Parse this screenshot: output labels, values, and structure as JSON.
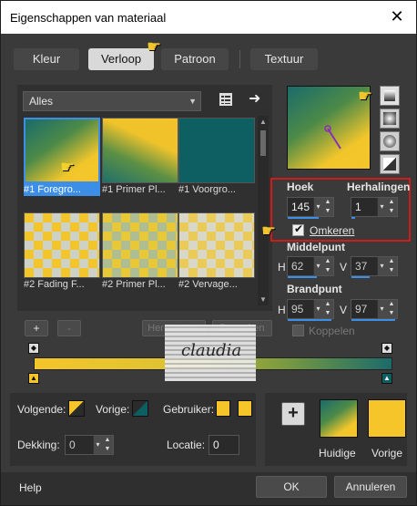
{
  "window": {
    "title": "Eigenschappen van materiaal",
    "close_glyph": "✕"
  },
  "tabs": [
    {
      "label": "Kleur",
      "active": false
    },
    {
      "label": "Verloop",
      "active": true
    },
    {
      "label": "Patroon",
      "active": false
    },
    {
      "label": "Textuur",
      "active": false
    }
  ],
  "library": {
    "category": "Alles",
    "items": [
      {
        "label": "#1 Foregro...",
        "style": "grad-tl",
        "selected": true
      },
      {
        "label": "#1 Primer Pl...",
        "style": "grad-b1",
        "selected": false
      },
      {
        "label": "#1 Voorgro...",
        "style": "teal",
        "selected": false
      },
      {
        "label": "#2 Fading F...",
        "style": "check1",
        "selected": false
      },
      {
        "label": "#2 Primer Pl...",
        "style": "check2",
        "selected": false
      },
      {
        "label": "#2 Vervage...",
        "style": "check3",
        "selected": false
      }
    ],
    "add_label": "+",
    "remove_label": "-",
    "rename_label": "Hernoemen",
    "edit_label": "Bewerken"
  },
  "settings": {
    "angle_label": "Hoek",
    "angle_value": "145",
    "repeats_label": "Herhalingen",
    "repeats_value": "1",
    "invert_label": "Omkeren",
    "invert_checked": true,
    "center_label": "Middelpunt",
    "center_h_label": "H",
    "center_h": "62",
    "center_v_label": "V",
    "center_v": "37",
    "focal_label": "Brandpunt",
    "focal_h_label": "H",
    "focal_h": "95",
    "focal_v_label": "V",
    "focal_v": "97",
    "link_label": "Koppelen"
  },
  "stops": {
    "next_label": "Volgende:",
    "prev_label": "Vorige:",
    "user_label": "Gebruiker:",
    "opacity_label": "Dekking:",
    "opacity_value": "0",
    "location_label": "Locatie:",
    "location_value": "0"
  },
  "preview": {
    "current_label": "Huidige",
    "previous_label": "Vorige",
    "add_glyph": "+"
  },
  "footer": {
    "help_label": "Help",
    "ok_label": "OK",
    "cancel_label": "Annuleren"
  },
  "watermark": {
    "text": "claudia"
  },
  "colors": {
    "accent": "#3c8ee6",
    "yellow": "#f5c52a",
    "teal": "#0e5f62",
    "highlight_box": "#d11a1a"
  }
}
